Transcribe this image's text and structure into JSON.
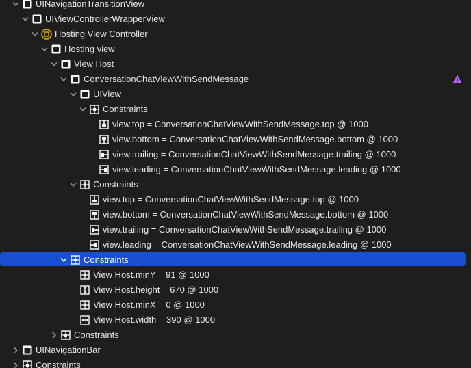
{
  "tree": {
    "rows": [
      {
        "label": "UINavigationTransitionView",
        "icon": "view-icon",
        "disclosure": "expanded"
      },
      {
        "label": "UIViewControllerWrapperView",
        "icon": "view-icon",
        "disclosure": "expanded"
      },
      {
        "label": "Hosting View Controller",
        "icon": "view-controller-icon",
        "disclosure": "expanded"
      },
      {
        "label": "Hosting view",
        "icon": "hosting-view-icon",
        "disclosure": "expanded"
      },
      {
        "label": "View Host",
        "icon": "view-icon",
        "disclosure": "expanded"
      },
      {
        "label": "ConversationChatViewWithSendMessage",
        "icon": "view-icon",
        "disclosure": "expanded",
        "warning_icon": "purple-warning-icon"
      },
      {
        "label": "UIView",
        "icon": "view-icon",
        "disclosure": "expanded"
      },
      {
        "label": "Constraints",
        "icon": "constraints-group-icon",
        "disclosure": "expanded"
      },
      {
        "label": "view.top = ConversationChatViewWithSendMessage.top @ 1000",
        "icon": "top-constraint-icon",
        "disclosure": "none"
      },
      {
        "label": "view.bottom = ConversationChatViewWithSendMessage.bottom @ 1000",
        "icon": "bottom-constraint-icon",
        "disclosure": "none"
      },
      {
        "label": "view.trailing = ConversationChatViewWithSendMessage.trailing @ 1000",
        "icon": "trailing-constraint-icon",
        "disclosure": "none"
      },
      {
        "label": "view.leading = ConversationChatViewWithSendMessage.leading @ 1000",
        "icon": "leading-constraint-icon",
        "disclosure": "none"
      },
      {
        "label": "Constraints",
        "icon": "constraints-group-icon",
        "disclosure": "expanded"
      },
      {
        "label": "view.top = ConversationChatViewWithSendMessage.top @ 1000",
        "icon": "top-constraint-icon",
        "disclosure": "none"
      },
      {
        "label": "view.bottom = ConversationChatViewWithSendMessage.bottom @ 1000",
        "icon": "bottom-constraint-icon",
        "disclosure": "none"
      },
      {
        "label": "view.trailing = ConversationChatViewWithSendMessage.trailing @ 1000",
        "icon": "trailing-constraint-icon",
        "disclosure": "none"
      },
      {
        "label": "view.leading = ConversationChatViewWithSendMessage.leading @ 1000",
        "icon": "leading-constraint-icon",
        "disclosure": "none"
      },
      {
        "label": "Constraints",
        "icon": "constraints-group-icon",
        "disclosure": "expanded",
        "selected": true
      },
      {
        "label": "View Host.minY = 91 @ 1000",
        "icon": "constraint-icon",
        "disclosure": "none"
      },
      {
        "label": "View Host.height = 670 @ 1000",
        "icon": "height-constraint-icon",
        "disclosure": "none"
      },
      {
        "label": "View Host.minX = 0 @ 1000",
        "icon": "constraint-icon",
        "disclosure": "none"
      },
      {
        "label": "View Host.width = 390 @ 1000",
        "icon": "width-constraint-icon",
        "disclosure": "none"
      },
      {
        "label": "Constraints",
        "icon": "constraints-group-icon",
        "disclosure": "collapsed"
      },
      {
        "label": "UINavigationBar",
        "icon": "nav-bar-icon",
        "disclosure": "collapsed"
      },
      {
        "label": "Constraints",
        "icon": "constraints-group-icon",
        "disclosure": "collapsed"
      }
    ]
  },
  "colors": {
    "background": "#1e1e1e",
    "selection": "#1a4fd1",
    "text": "#e6e6e6",
    "warning": "#b56cf0",
    "vc_icon": "#e0b000"
  }
}
